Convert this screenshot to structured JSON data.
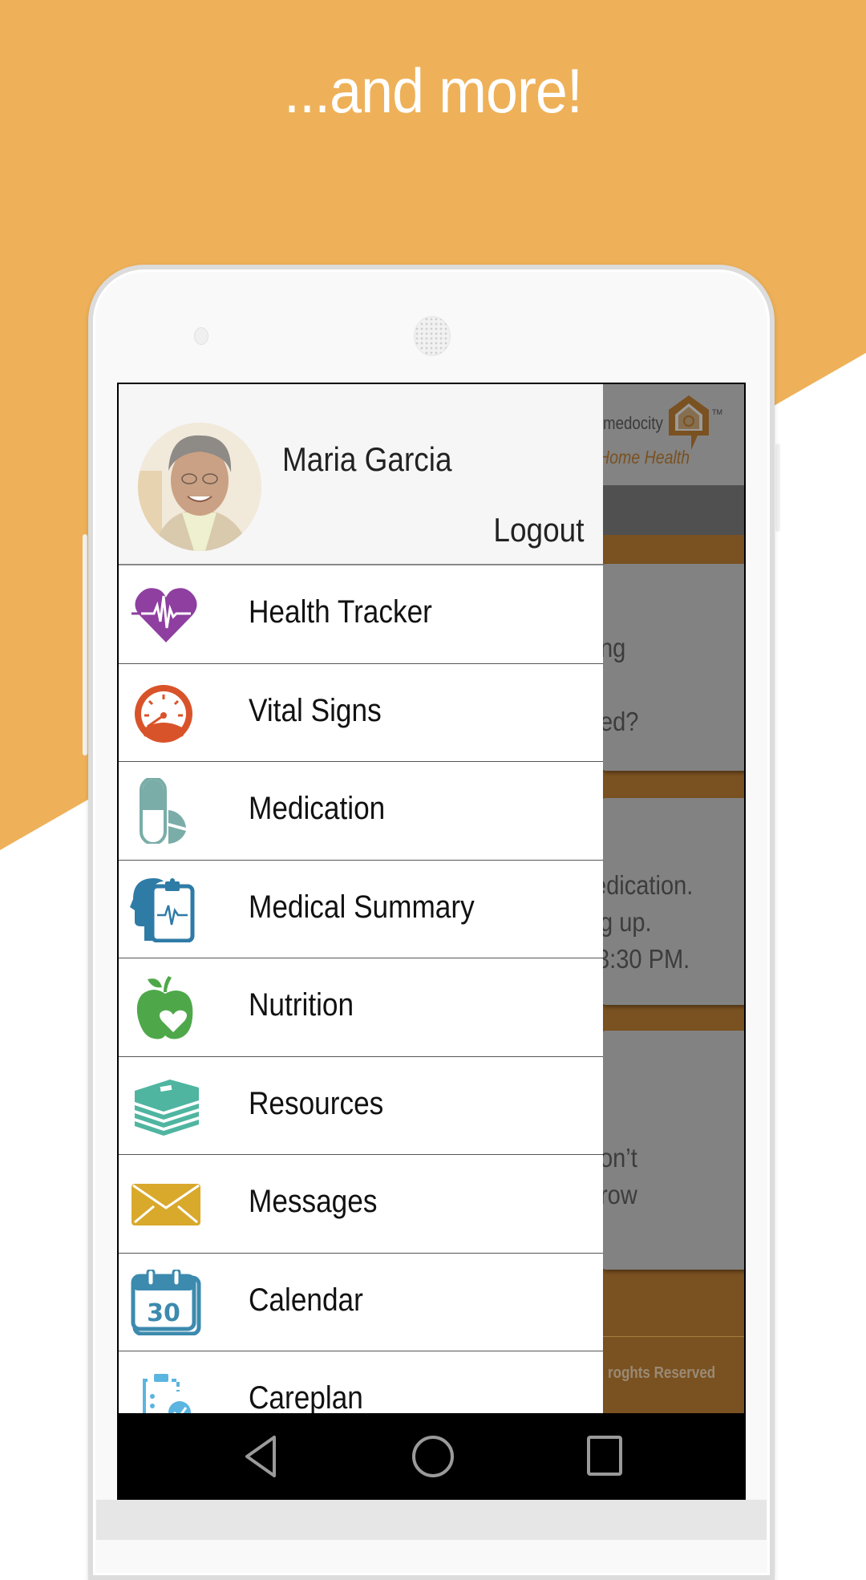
{
  "promo": {
    "headline": "...and more!",
    "colors": {
      "background": "#EEB159",
      "headline": "#FFFFFF"
    }
  },
  "app": {
    "brand": {
      "name": "medocity",
      "subtitle": "Home Health",
      "trademark": "TM"
    },
    "cards": [
      {
        "lines": [
          "ng",
          "",
          "ed?"
        ]
      },
      {
        "lines": [
          "edication.",
          "g up.",
          "3:30 PM."
        ]
      },
      {
        "lines": [
          "",
          "on’t",
          "row"
        ]
      }
    ],
    "footer": "roghts Reserved",
    "colors": {
      "body": "#7A5120",
      "header": "#838383",
      "subbar": "#505050",
      "card": "#828282"
    }
  },
  "drawer": {
    "user": {
      "name": "Maria Garcia",
      "logout_label": "Logout"
    },
    "menu": [
      {
        "label": "Health Tracker",
        "icon": "heart-pulse-icon",
        "color": "#8E3FA0"
      },
      {
        "label": "Vital Signs",
        "icon": "speedometer-icon",
        "color": "#D9532A"
      },
      {
        "label": "Medication",
        "icon": "pill-icon",
        "color": "#7AADA8"
      },
      {
        "label": "Medical Summary",
        "icon": "head-clipboard-icon",
        "color": "#2E7BA6"
      },
      {
        "label": "Nutrition",
        "icon": "apple-heart-icon",
        "color": "#4EA84A"
      },
      {
        "label": "Resources",
        "icon": "books-icon",
        "color": "#4FB5A0"
      },
      {
        "label": "Messages",
        "icon": "envelope-icon",
        "color": "#D9A92C"
      },
      {
        "label": "Calendar",
        "icon": "calendar-icon",
        "color": "#3C8AAE",
        "icon_text": "30"
      },
      {
        "label": "Careplan",
        "icon": "clipboard-check-icon",
        "color": "#5BB5E0"
      }
    ]
  },
  "navbar": {
    "buttons": [
      {
        "name": "back",
        "icon": "back-triangle-icon"
      },
      {
        "name": "home",
        "icon": "home-circle-icon"
      },
      {
        "name": "recents",
        "icon": "recents-square-icon"
      }
    ]
  }
}
